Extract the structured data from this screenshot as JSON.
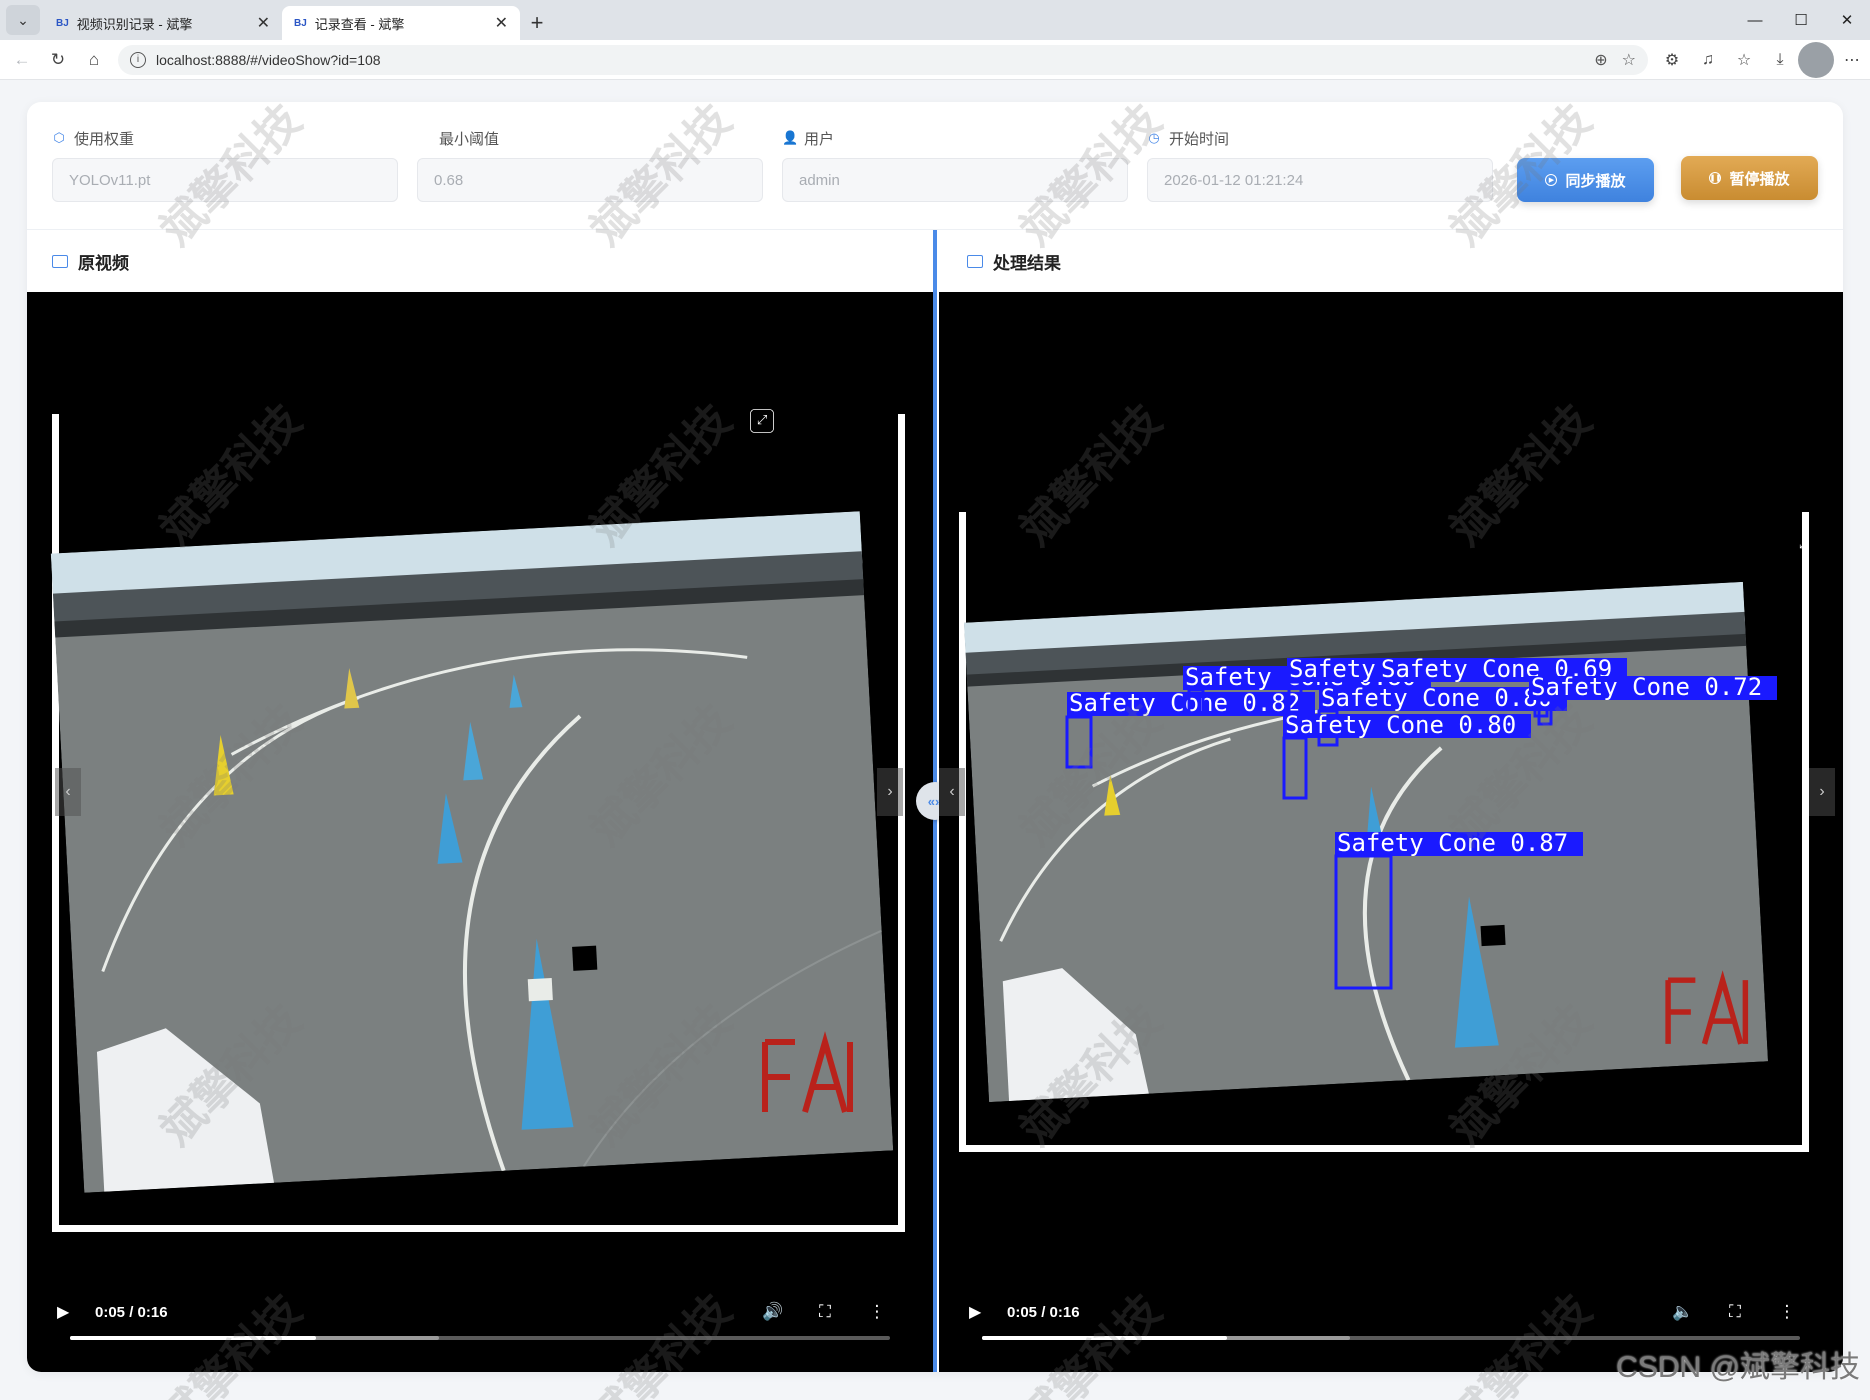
{
  "browser": {
    "tabs": [
      {
        "favicon": "BJ",
        "title": "视频识别记录 - 斌擎"
      },
      {
        "favicon": "BJ",
        "title": "记录查看 - 斌擎"
      }
    ],
    "url": "localhost:8888/#/videoShow?id=108"
  },
  "filters": {
    "weight": {
      "label": "使用权重",
      "value": "YOLOv11.pt"
    },
    "threshold": {
      "label": "最小阈值",
      "value": "0.68"
    },
    "user": {
      "label": "用户",
      "value": "admin"
    },
    "start_time": {
      "label": "开始时间",
      "value": "2026-01-12 01:21:24"
    }
  },
  "buttons": {
    "sync": "同步播放",
    "pause": "暂停播放"
  },
  "panes": {
    "original": {
      "title": "原视频"
    },
    "result": {
      "title": "处理结果"
    }
  },
  "player_left": {
    "time": "0:05 / 0:16",
    "progress": 0.3,
    "buffered": 0.45
  },
  "player_right": {
    "time": "0:05 / 0:16",
    "progress": 0.3,
    "buffered": 0.45
  },
  "detections": [
    {
      "label": "Safety Cone 0.82"
    },
    {
      "label": "Safety Cone 0.80"
    },
    {
      "label": "Safety Cone 0.75"
    },
    {
      "label": "Safety Cone 0.69"
    },
    {
      "label": "Safety Cone 0.80"
    },
    {
      "label": "Safety Cone 0.72"
    },
    {
      "label": "Safety Cone 0.80"
    },
    {
      "label": "Safety Cone 0.87"
    }
  ],
  "watermark": "斌擎科技",
  "footer_watermark": "CSDN @斌擎科技",
  "colors": {
    "accent": "#4a8ae8",
    "sync_button": "#4a8ae8",
    "pause_button": "#d69b42",
    "detection_box": "#1a1aff"
  }
}
